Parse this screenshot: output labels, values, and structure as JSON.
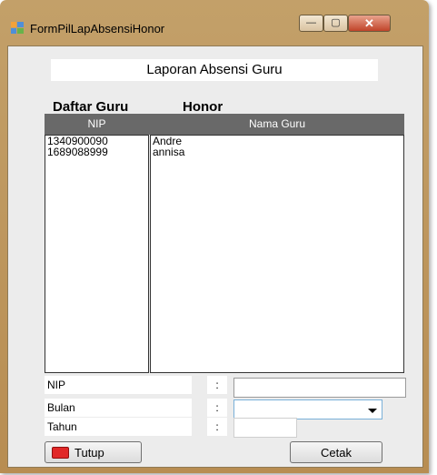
{
  "window": {
    "title": "FormPilLapAbsensiHonor",
    "controls": {
      "minimize": "—",
      "maximize": "▢",
      "close": "✕"
    }
  },
  "form": {
    "report_title": "Laporan Absensi Guru",
    "daftar_label": "Daftar Guru",
    "honor_label": "Honor"
  },
  "grid": {
    "columns": [
      "NIP",
      "Nama Guru"
    ],
    "rows": [
      {
        "nip": "1340900090",
        "nama": "Andre"
      },
      {
        "nip": "1689088999",
        "nama": "annisa"
      }
    ]
  },
  "fields": {
    "nip_label": "NIP",
    "bulan_label": "Bulan",
    "tahun_label": "Tahun",
    "colon": ":",
    "nip_value": "",
    "bulan_value": "",
    "tahun_value": ""
  },
  "buttons": {
    "tutup": "Tutup",
    "cetak": "Cetak"
  },
  "colors": {
    "frame": "#c3a069",
    "grid_header": "#696969",
    "close_button": "#c0442a",
    "tutup_icon": "#e12828"
  }
}
